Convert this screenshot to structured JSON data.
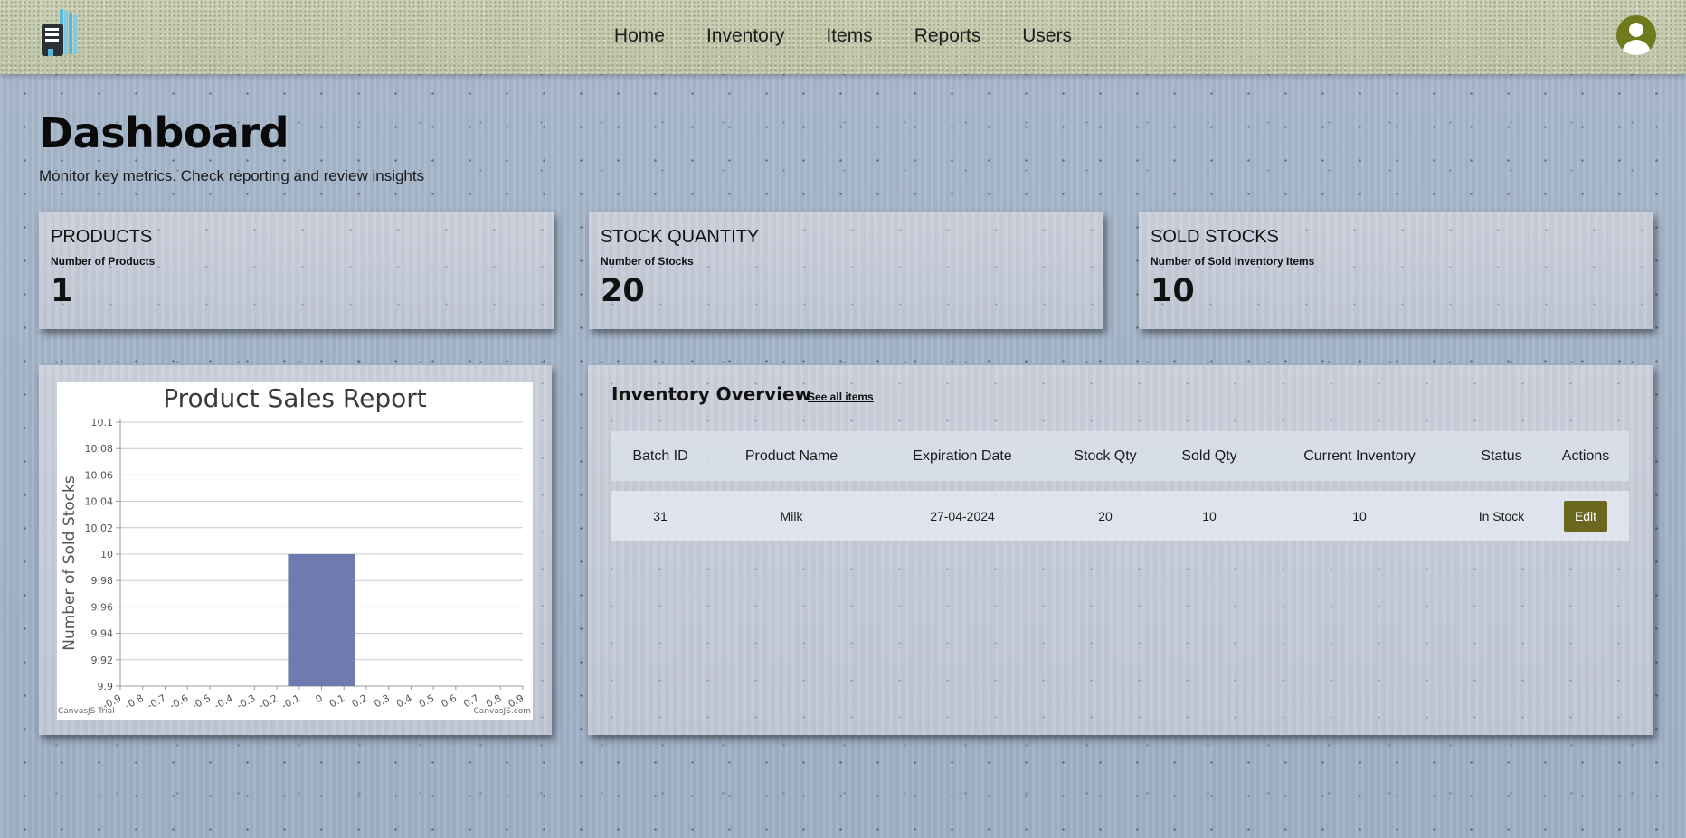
{
  "nav": {
    "items": [
      "Home",
      "Inventory",
      "Items",
      "Reports",
      "Users"
    ]
  },
  "header": {
    "title": "Dashboard",
    "subtitle": "Monitor key metrics. Check reporting and review insights"
  },
  "stats": [
    {
      "title": "PRODUCTS",
      "subtitle": "Number of Products",
      "value": "1"
    },
    {
      "title": "STOCK QUANTITY",
      "subtitle": "Number of Stocks",
      "value": "20"
    },
    {
      "title": "SOLD STOCKS",
      "subtitle": "Number of Sold Inventory Items",
      "value": "10"
    }
  ],
  "chart_data": {
    "type": "bar",
    "title": "Product Sales Report",
    "ylabel": "Number of Sold Stocks",
    "xlabel": "",
    "ylim": [
      9.9,
      10.1
    ],
    "yticks": [
      "9.9",
      "9.92",
      "9.94",
      "9.96",
      "9.98",
      "10",
      "10.02",
      "10.04",
      "10.06",
      "10.08",
      "10.1"
    ],
    "xlim": [
      -0.9,
      0.9
    ],
    "xticks": [
      "-0.9",
      "-0.8",
      "-0.7",
      "-0.6",
      "-0.5",
      "-0.4",
      "-0.3",
      "-0.2",
      "-0.1",
      "0",
      "0.1",
      "0.2",
      "0.3",
      "0.4",
      "0.5",
      "0.6",
      "0.7",
      "0.8",
      "0.9"
    ],
    "bars": [
      {
        "x": 0,
        "value": 10
      }
    ],
    "bar_color": "#6f7bb0",
    "grid": true,
    "watermark_left": "CanvasJS Trial",
    "watermark_right": "CanvasJS.com"
  },
  "inventory": {
    "title": "Inventory Overview",
    "link": "See all items",
    "columns": [
      "Batch ID",
      "Product Name",
      "Expiration Date",
      "Stock Qty",
      "Sold Qty",
      "Current Inventory",
      "Status",
      "Actions"
    ],
    "rows": [
      {
        "batch_id": "31",
        "product": "Milk",
        "expiration": "27-04-2024",
        "stock_qty": "20",
        "sold_qty": "10",
        "current": "10",
        "status": "In Stock",
        "action": "Edit"
      }
    ]
  },
  "colors": {
    "nav_bg": "#c7ccb2",
    "avatar": "#6f7a1c",
    "edit_button": "#6a681e",
    "page_bg": "#a4b4c8"
  },
  "icons": {
    "logo": "building-logo-icon",
    "avatar": "user-avatar-icon"
  }
}
